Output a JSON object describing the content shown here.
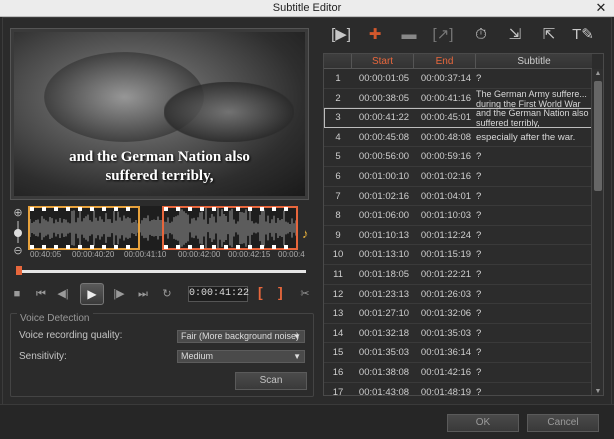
{
  "window": {
    "title": "Subtitle Editor",
    "close_label": "✕"
  },
  "preview": {
    "caption": "and the German Nation also\nsuffered terribly,"
  },
  "waveform": {
    "ticks": [
      "00:40:05",
      "00:00:40:20",
      "00:00:41:10",
      "00:00:42:00",
      "00:00:42:15",
      "00:00:4"
    ]
  },
  "transport": {
    "timecode": "0:00:41:22",
    "mark_in": "[",
    "mark_out": "]",
    "icons": [
      "stop-icon",
      "go-to-start-icon",
      "step-back-icon",
      "play-icon",
      "step-forward-icon",
      "go-to-end-icon",
      "repeat-icon",
      "split-icon"
    ]
  },
  "voice_detection": {
    "legend": "Voice Detection",
    "quality_label": "Voice recording quality:",
    "quality_value": "Fair (More background noise)",
    "sensitivity_label": "Sensitivity:",
    "sensitivity_value": "Medium",
    "scan_label": "Scan"
  },
  "toolbar": {
    "icons": [
      "play-subtitle-icon",
      "add-subtitle-icon",
      "remove-subtitle-icon",
      "merge-subtitle-icon",
      "time-offset-icon",
      "import-subtitle-icon",
      "export-subtitle-icon",
      "text-options-icon"
    ]
  },
  "table": {
    "headers": {
      "num": "",
      "start": "Start",
      "end": "End",
      "subtitle": "Subtitle"
    },
    "header_colors": {
      "start": "#e8673c",
      "end": "#e8673c",
      "subtitle": "#cfcfcf"
    },
    "rows": [
      {
        "n": "1",
        "start": "00:00:01:05",
        "end": "00:00:37:14",
        "text": "?"
      },
      {
        "n": "2",
        "start": "00:00:38:05",
        "end": "00:00:41:16",
        "text": "The German Army suffere... during the First World War",
        "wrap": true
      },
      {
        "n": "3",
        "start": "00:00:41:22",
        "end": "00:00:45:01",
        "text": "and the German Nation also suffered terribly,",
        "wrap": true,
        "selected": true
      },
      {
        "n": "4",
        "start": "00:00:45:08",
        "end": "00:00:48:08",
        "text": "especially after the war."
      },
      {
        "n": "5",
        "start": "00:00:56:00",
        "end": "00:00:59:16",
        "text": "?"
      },
      {
        "n": "6",
        "start": "00:01:00:10",
        "end": "00:01:02:16",
        "text": "?"
      },
      {
        "n": "7",
        "start": "00:01:02:16",
        "end": "00:01:04:01",
        "text": "?"
      },
      {
        "n": "8",
        "start": "00:01:06:00",
        "end": "00:01:10:03",
        "text": "?"
      },
      {
        "n": "9",
        "start": "00:01:10:13",
        "end": "00:01:12:24",
        "text": "?"
      },
      {
        "n": "10",
        "start": "00:01:13:10",
        "end": "00:01:15:19",
        "text": "?"
      },
      {
        "n": "11",
        "start": "00:01:18:05",
        "end": "00:01:22:21",
        "text": "?"
      },
      {
        "n": "12",
        "start": "00:01:23:13",
        "end": "00:01:26:03",
        "text": "?"
      },
      {
        "n": "13",
        "start": "00:01:27:10",
        "end": "00:01:32:06",
        "text": "?"
      },
      {
        "n": "14",
        "start": "00:01:32:18",
        "end": "00:01:35:03",
        "text": "?"
      },
      {
        "n": "15",
        "start": "00:01:35:03",
        "end": "00:01:36:14",
        "text": "?"
      },
      {
        "n": "16",
        "start": "00:01:38:08",
        "end": "00:01:42:16",
        "text": "?"
      },
      {
        "n": "17",
        "start": "00:01:43:08",
        "end": "00:01:48:19",
        "text": "?"
      }
    ]
  },
  "footer": {
    "ok_label": "OK",
    "cancel_label": "Cancel"
  }
}
